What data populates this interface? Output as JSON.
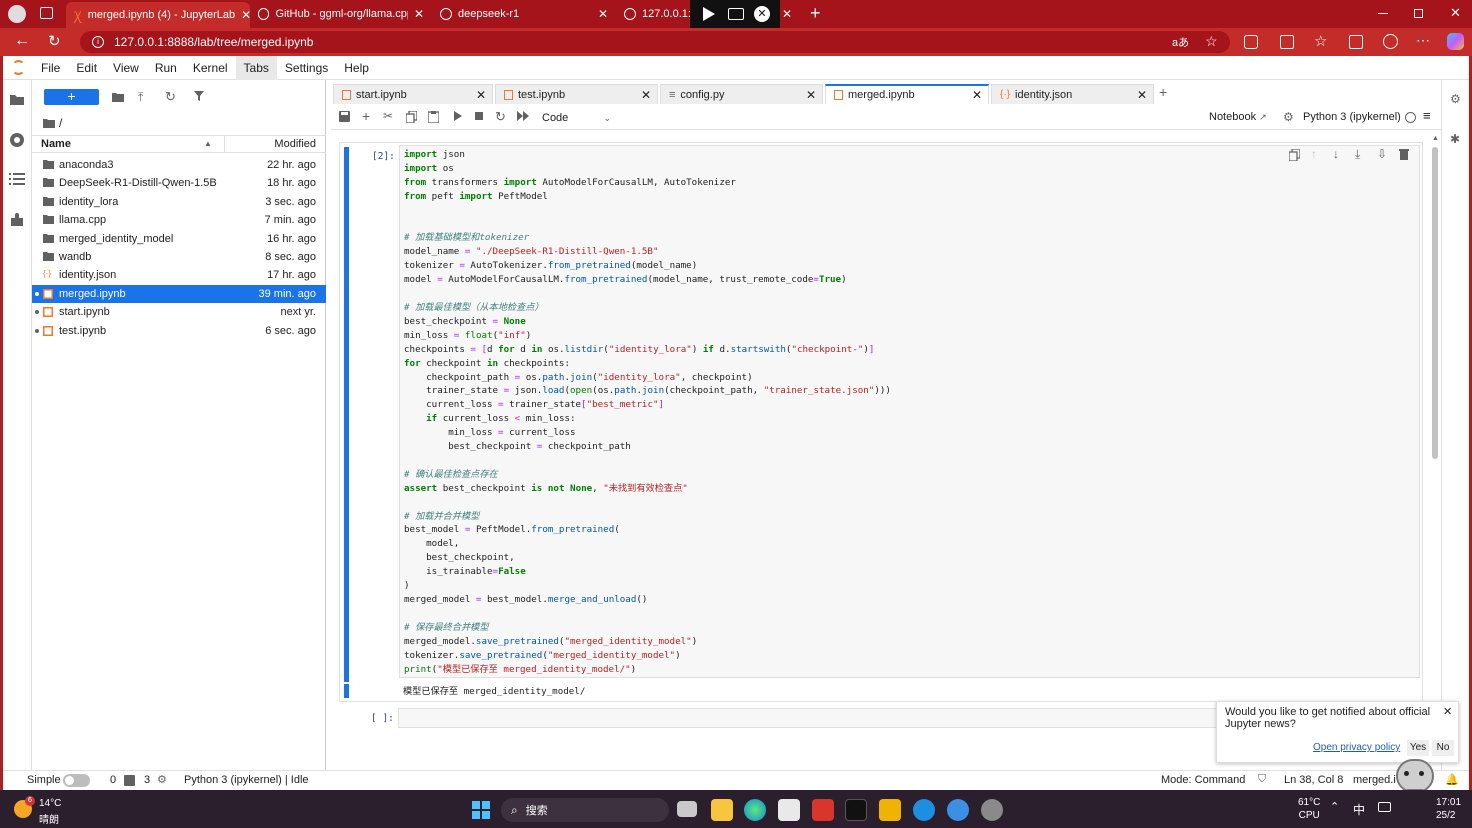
{
  "browser": {
    "tabs": [
      {
        "label": "merged.ipynb (4) - JupyterLab",
        "active": true
      },
      {
        "label": "GitHub - ggml-org/llama.cpp: LLM"
      },
      {
        "label": "deepseek-r1"
      },
      {
        "label": "127.0.0.1:11"
      }
    ],
    "url": "127.0.0.1:8888/lab/tree/merged.ipynb"
  },
  "menubar": [
    "File",
    "Edit",
    "View",
    "Run",
    "Kernel",
    "Tabs",
    "Settings",
    "Help"
  ],
  "filebrowser": {
    "new_button": "+",
    "path": "/",
    "header_name": "Name",
    "header_modified": "Modified",
    "rows": [
      {
        "name": "anaconda3",
        "modified": "22 hr. ago",
        "type": "folder"
      },
      {
        "name": "DeepSeek-R1-Distill-Qwen-1.5B",
        "modified": "18 hr. ago",
        "type": "folder"
      },
      {
        "name": "identity_lora",
        "modified": "3 sec. ago",
        "type": "folder"
      },
      {
        "name": "llama.cpp",
        "modified": "7 min. ago",
        "type": "folder"
      },
      {
        "name": "merged_identity_model",
        "modified": "16 hr. ago",
        "type": "folder"
      },
      {
        "name": "wandb",
        "modified": "8 sec. ago",
        "type": "folder"
      },
      {
        "name": "identity.json",
        "modified": "17 hr. ago",
        "type": "json"
      },
      {
        "name": "merged.ipynb",
        "modified": "39 min. ago",
        "type": "notebook",
        "selected": true
      },
      {
        "name": "start.ipynb",
        "modified": "next yr.",
        "type": "notebook"
      },
      {
        "name": "test.ipynb",
        "modified": "6 sec. ago",
        "type": "notebook"
      }
    ]
  },
  "doc_tabs": [
    {
      "label": "start.ipynb"
    },
    {
      "label": "test.ipynb"
    },
    {
      "label": "config.py"
    },
    {
      "label": "merged.ipynb",
      "active": true
    },
    {
      "label": "identity.json"
    }
  ],
  "nb_toolbar": {
    "cell_type": "Code",
    "notebook_link": "Notebook",
    "kernel": "Python 3 (ipykernel)"
  },
  "cell1": {
    "prompt": "[2]:",
    "lines": [
      "import json",
      "import os",
      "from transformers import AutoModelForCausalLM, AutoTokenizer",
      "from peft import PeftModel",
      "",
      "",
      "# 加载基础模型和tokenizer",
      "model_name = \"./DeepSeek-R1-Distill-Qwen-1.5B\"",
      "tokenizer = AutoTokenizer.from_pretrained(model_name)",
      "model = AutoModelForCausalLM.from_pretrained(model_name, trust_remote_code=True)",
      "",
      "# 加载最佳模型（从本地检查点）",
      "best_checkpoint = None",
      "min_loss = float(\"inf\")",
      "checkpoints = [d for d in os.listdir(\"identity_lora\") if d.startswith(\"checkpoint-\")]",
      "for checkpoint in checkpoints:",
      "    checkpoint_path = os.path.join(\"identity_lora\", checkpoint)",
      "    trainer_state = json.load(open(os.path.join(checkpoint_path, \"trainer_state.json\")))",
      "    current_loss = trainer_state[\"best_metric\"]",
      "    if current_loss < min_loss:",
      "        min_loss = current_loss",
      "        best_checkpoint = checkpoint_path",
      "",
      "# 确认最佳检查点存在",
      "assert best_checkpoint is not None, \"未找到有效检查点\"",
      "",
      "# 加载并合并模型",
      "best_model = PeftModel.from_pretrained(",
      "    model,",
      "    best_checkpoint,",
      "    is_trainable=False",
      ")",
      "merged_model = best_model.merge_and_unload()",
      "",
      "# 保存最终合并模型",
      "merged_model.save_pretrained(\"merged_identity_model\")",
      "tokenizer.save_pretrained(\"merged_identity_model\")",
      "print(\"模型已保存至 merged_identity_model/\")"
    ],
    "output": "模型已保存至 merged_identity_model/"
  },
  "cell2": {
    "prompt": "[ ]:"
  },
  "notification": {
    "text": "Would you like to get notified about official Jupyter news?",
    "link": "Open privacy policy",
    "yes": "Yes",
    "no": "No"
  },
  "statusbar": {
    "mode_label": "Simple",
    "count_a": "0",
    "count_b": "3",
    "kernel_status": "Python 3 (ipykernel) | Idle",
    "mode": "Mode: Command",
    "position": "Ln 38, Col 8",
    "file": "merged.i"
  },
  "taskbar": {
    "weather_temp": "14°C",
    "weather_desc": "晴朗",
    "weather_badge": "6",
    "search": "搜索",
    "cpu_temp": "61°C",
    "cpu_label": "CPU",
    "ime": "中",
    "time": "17:01",
    "date": "25/2"
  },
  "colors": {
    "accent": "#1a73e8",
    "browser_red": "#c42c2a",
    "browser_dark": "#a5141a"
  }
}
